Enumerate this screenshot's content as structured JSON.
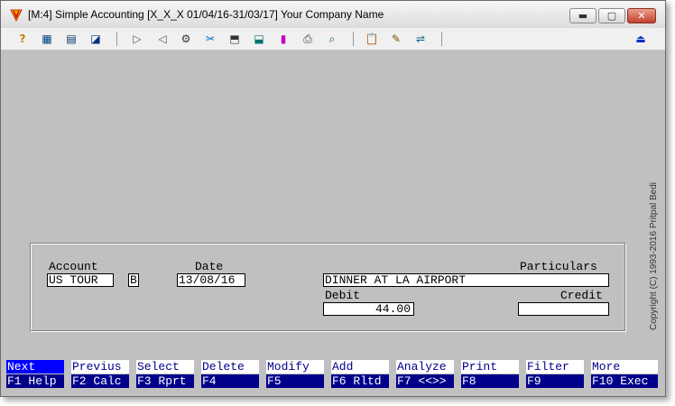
{
  "title": "[M:4]  Simple Accounting  [X_X_X  01/04/16-31/03/17]  Your Company Name",
  "window_controls": {
    "minimize": "▬",
    "maximize": "▢",
    "close": "✕"
  },
  "toolbar": {
    "icons": [
      "help-icon",
      "grid-icon",
      "calendar-icon",
      "chart-icon",
      "forward-icon",
      "back-icon",
      "settings-icon",
      "tools-icon",
      "import-icon",
      "export-icon",
      "bar-chart-icon",
      "printer-icon",
      "search-icon",
      "clipboard-icon",
      "wizard-icon",
      "toggle-icon",
      "exit-icon"
    ],
    "glyphs": {
      "help": "?",
      "grid": "▦",
      "calendar": "▤",
      "chart": "◪",
      "forward": "▷",
      "back": "◁",
      "settings": "⚙",
      "tools": "✂",
      "import": "⬒",
      "export": "⬓",
      "bar": "▮",
      "printer": "⎙",
      "search": "⌕",
      "clipboard": "📋",
      "wizard": "✎",
      "toggle": "⇌",
      "exit": "⏏"
    }
  },
  "copyright": "Copyright  (C)  1993-2016   Pritpal Bedi",
  "form": {
    "account_label": "Account",
    "account_value": "US TOUR",
    "account_type": "B",
    "date_label": "Date",
    "date_value": "13/08/16",
    "particulars_label": "Particulars",
    "particulars_value": "DINNER AT LA AIRPORT",
    "debit_label": "Debit",
    "debit_value": "44.00",
    "credit_label": "Credit",
    "credit_value": ""
  },
  "function_keys": [
    {
      "label": "Next",
      "key": "F1 Help"
    },
    {
      "label": "Previus",
      "key": "F2 Calc"
    },
    {
      "label": "Select",
      "key": "F3 Rprt"
    },
    {
      "label": "Delete",
      "key": "F4"
    },
    {
      "label": "Modify",
      "key": "F5"
    },
    {
      "label": "Add",
      "key": "F6 Rltd"
    },
    {
      "label": "Analyze",
      "key": "F7 <<>>"
    },
    {
      "label": "Print",
      "key": "F8"
    },
    {
      "label": "Filter",
      "key": "F9"
    },
    {
      "label": "More",
      "key": "F10 Exec"
    }
  ],
  "colors": {
    "bg": "#c0c0c0",
    "fkey_blue": "#00008b",
    "active_blue": "#0000ff"
  }
}
